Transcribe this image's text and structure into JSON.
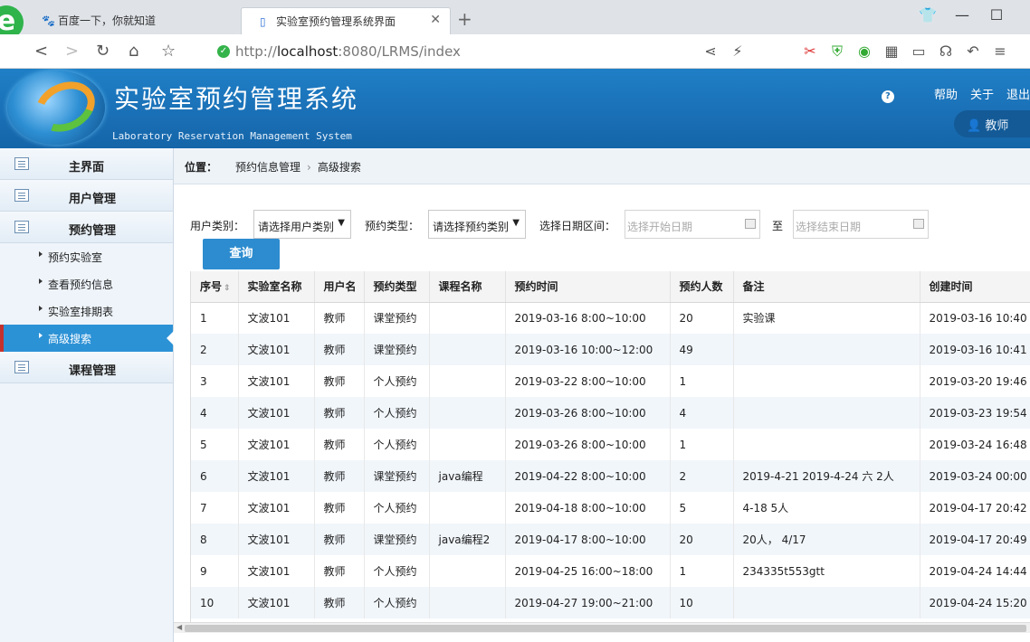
{
  "browser": {
    "tabs": [
      {
        "title": "百度一下，你就知道",
        "icon": "paw-icon"
      },
      {
        "title": "实验室预约管理系统界面",
        "icon": "page-icon"
      }
    ],
    "url_prefix": "http://",
    "url_host": "localhost",
    "url_rest": ":8080/LRMS/index"
  },
  "header": {
    "title": "实验室预约管理系统",
    "subtitle": "Laboratory Reservation Management System",
    "help": "帮助",
    "about": "关于",
    "logout": "退出",
    "role": "教师",
    "help_icon_text": "?"
  },
  "sidebar": {
    "groups": [
      {
        "label": "主界面"
      },
      {
        "label": "用户管理"
      },
      {
        "label": "预约管理"
      },
      {
        "label": "课程管理"
      }
    ],
    "items": [
      {
        "label": "预约实验室"
      },
      {
        "label": "查看预约信息"
      },
      {
        "label": "实验室排期表"
      },
      {
        "label": "高级搜索"
      }
    ]
  },
  "breadcrumb": {
    "label": "位置：",
    "crumbs": [
      "预约信息管理",
      "高级搜索"
    ]
  },
  "filters": {
    "user_type_label": "用户类别：",
    "user_type_value": "请选择用户类别",
    "booking_type_label": "预约类型：",
    "booking_type_value": "请选择预约类别",
    "date_range_label": "选择日期区间：",
    "start_placeholder": "选择开始日期",
    "to_label": "至",
    "end_placeholder": "选择结束日期",
    "query_button": "查询"
  },
  "table": {
    "columns": [
      "序号",
      "实验室名称",
      "用户名",
      "预约类型",
      "课程名称",
      "预约时间",
      "预约人数",
      "备注",
      "创建时间"
    ],
    "rows": [
      [
        "1",
        "文波101",
        "教师",
        "课堂预约",
        "",
        "2019-03-16 8:00~10:00",
        "20",
        "实验课",
        "2019-03-16 10:40"
      ],
      [
        "2",
        "文波101",
        "教师",
        "课堂预约",
        "",
        "2019-03-16 10:00~12:00",
        "49",
        "",
        "2019-03-16 10:41"
      ],
      [
        "3",
        "文波101",
        "教师",
        "个人预约",
        "",
        "2019-03-22 8:00~10:00",
        "1",
        "",
        "2019-03-20 19:46"
      ],
      [
        "4",
        "文波101",
        "教师",
        "个人预约",
        "",
        "2019-03-26 8:00~10:00",
        "4",
        "",
        "2019-03-23 19:54"
      ],
      [
        "5",
        "文波101",
        "教师",
        "个人预约",
        "",
        "2019-03-26 8:00~10:00",
        "1",
        "",
        "2019-03-24 16:48"
      ],
      [
        "6",
        "文波101",
        "教师",
        "课堂预约",
        "java编程",
        "2019-04-22 8:00~10:00",
        "2",
        "2019-4-21 2019-4-24 六 2人",
        "2019-03-24 00:00"
      ],
      [
        "7",
        "文波101",
        "教师",
        "个人预约",
        "",
        "2019-04-18 8:00~10:00",
        "5",
        "4-18 5人",
        "2019-04-17 20:42"
      ],
      [
        "8",
        "文波101",
        "教师",
        "课堂预约",
        "java编程2",
        "2019-04-17 8:00~10:00",
        "20",
        "20人， 4/17",
        "2019-04-17 20:49"
      ],
      [
        "9",
        "文波101",
        "教师",
        "个人预约",
        "",
        "2019-04-25 16:00~18:00",
        "1",
        "234335t553gtt",
        "2019-04-24 14:44"
      ],
      [
        "10",
        "文波101",
        "教师",
        "个人预约",
        "",
        "2019-04-27 19:00~21:00",
        "10",
        "",
        "2019-04-24 15:20"
      ]
    ]
  },
  "colors": {
    "header_blue": "#1a6fb5",
    "active_item": "#2c92d6",
    "active_marker": "#c4322e",
    "button_blue": "#2d8ccf"
  }
}
